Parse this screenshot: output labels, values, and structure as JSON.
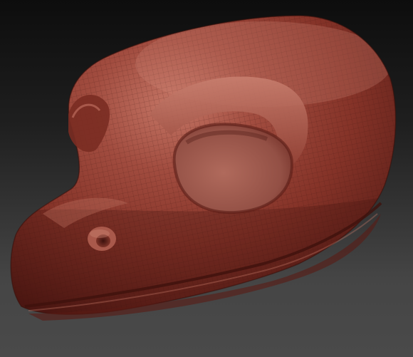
{
  "scene": {
    "subject": "sculpted-reptile-head",
    "colors": {
      "background_top": "#0d0d0d",
      "background_bottom": "#4a4a4a",
      "clay_base": "#8e3a2e",
      "clay_light": "#c87a69",
      "clay_dark": "#4a1611",
      "eye_socket": "#9c5447",
      "wireframe": "#3c140f"
    }
  }
}
